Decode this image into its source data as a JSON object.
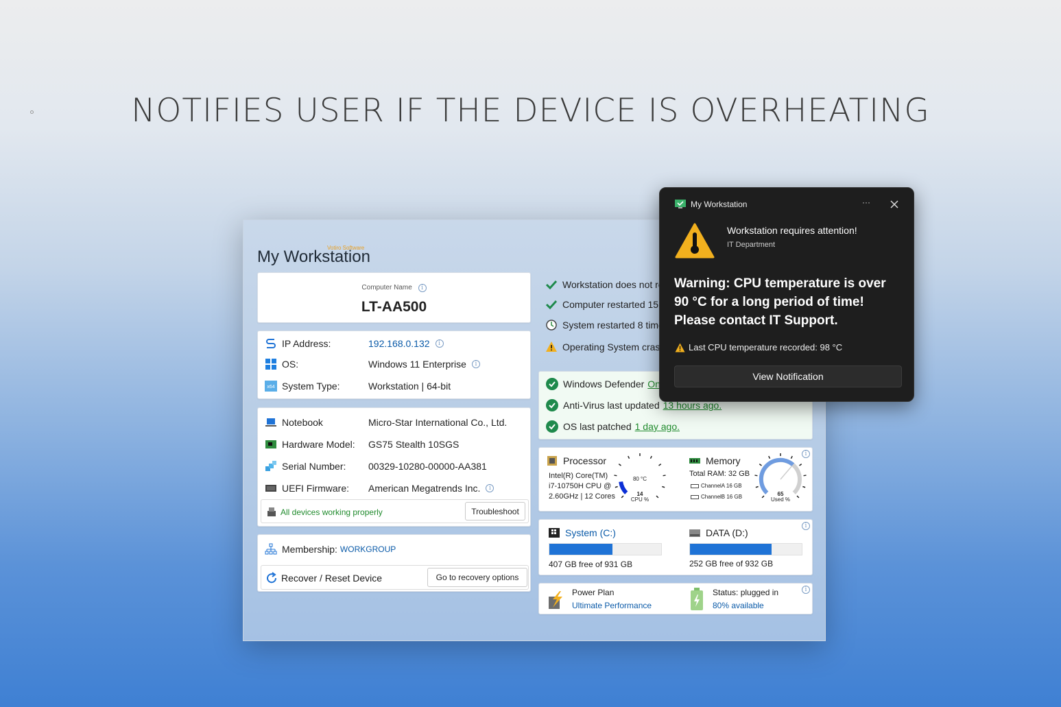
{
  "headline": "NOTIFIES USER IF THE DEVICE IS OVERHEATING",
  "window": {
    "title": "My Workstation",
    "brand": "Votiro Software"
  },
  "computer": {
    "label": "Computer Name",
    "name": "LT-AA500"
  },
  "network": {
    "ip_label": "IP Address:",
    "ip_value": "192.168.0.132",
    "os_label": "OS:",
    "os_value": "Windows 11 Enterprise",
    "type_label": "System Type:",
    "type_value": "Workstation | 64-bit"
  },
  "hardware": {
    "notebook_label": "Notebook",
    "notebook_value": "Micro-Star International Co., Ltd.",
    "model_label": "Hardware Model:",
    "model_value": "GS75 Stealth 10SGS",
    "serial_label": "Serial Number:",
    "serial_value": "00329-10280-00000-AA381",
    "uefi_label": "UEFI Firmware:",
    "uefi_value": "American Megatrends Inc.",
    "devices_status": "All devices working properly",
    "troubleshoot_label": "Troubleshoot"
  },
  "membership": {
    "label": "Membership:",
    "value": "WORKGROUP",
    "recover_label": "Recover / Reset Device",
    "recovery_button": "Go to recovery options"
  },
  "status_list": {
    "items": [
      "Workstation does not re",
      "Computer restarted 15",
      "System restarted 8 time",
      "Operating System crash"
    ]
  },
  "security": {
    "defender_label": "Windows Defender",
    "defender_value": "On",
    "av_label": "Anti-Virus last updated",
    "av_value": "13 hours ago.",
    "patch_label": "OS last patched",
    "patch_value": "1 day ago."
  },
  "processor": {
    "title": "Processor",
    "desc1": "Intel(R) Core(TM)",
    "desc2": "i7-10750H CPU @",
    "desc3": "2.60GHz | 12 Cores",
    "temp": "80 °C",
    "usage": "14",
    "usage_label": "CPU %",
    "usage_fraction": 0.14
  },
  "memory": {
    "title": "Memory",
    "total": "Total RAM: 32 GB",
    "channel_a": "ChannelA 16 GB",
    "channel_b": "ChannelB 16 GB",
    "used": "65",
    "used_label": "Used %",
    "used_fraction": 0.65
  },
  "drives": [
    {
      "name": "System (C:)",
      "free": "407 GB free of 931 GB",
      "used_fraction": 0.563
    },
    {
      "name": "DATA (D:)",
      "free": "252 GB free of 932 GB",
      "used_fraction": 0.73
    }
  ],
  "power": {
    "plan_label": "Power Plan",
    "plan_value": "Ultimate Performance",
    "status_label": "Status: plugged in",
    "status_value": "80% available"
  },
  "toast": {
    "app": "My Workstation",
    "more": "···",
    "title": "Workstation requires attention!",
    "source": "IT Department",
    "warning": "Warning: CPU temperature is over 90 °C for a long period of time! Please contact IT Support.",
    "last_temp": "Last CPU temperature recorded: 98 °C",
    "button": "View Notification"
  },
  "colors": {
    "accent": "#1f73d6",
    "ok": "#1f8a4c",
    "warn": "#f2b01e",
    "link": "#0a5aa8"
  }
}
